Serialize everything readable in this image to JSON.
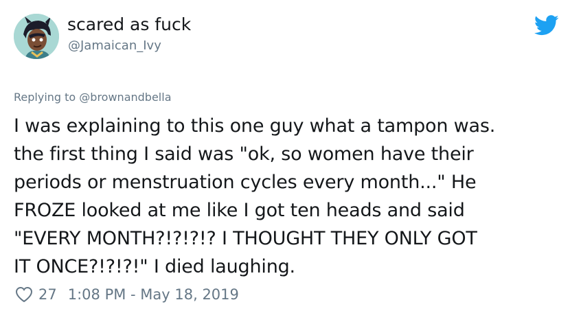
{
  "user": {
    "display_name": "scared as fuck",
    "handle": "@Jamaican_Ivy",
    "avatar_icon": "avatar-cartoon-character"
  },
  "reply": {
    "prefix": "Replying to ",
    "mention": "@brownandbella"
  },
  "tweet": {
    "text": "I was explaining to this one guy what a tampon was.\nthe first thing I said was \"ok, so women have their\nperiods or menstruation cycles every month...\" He\nFROZE looked at me like I got ten heads and said\n\"EVERY MONTH?!?!?!? I THOUGHT THEY ONLY GOT\nIT ONCE?!?!?!\" I died laughing."
  },
  "footer": {
    "likes": "27",
    "timestamp": "1:08 PM - May 18, 2019",
    "like_icon": "heart-icon"
  },
  "brand": {
    "logo_icon": "twitter-bird-icon",
    "accent_color": "#1da1f2"
  }
}
